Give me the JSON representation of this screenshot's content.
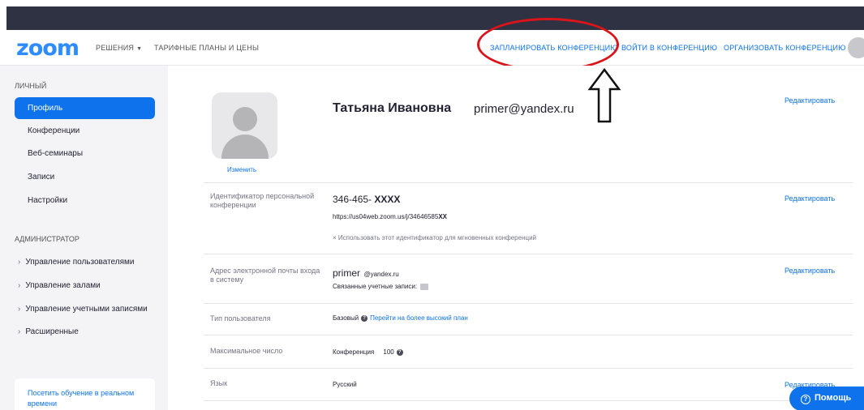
{
  "nav": {
    "logo": "zoom",
    "solutions": "РЕШЕНИЯ",
    "plans": "ТАРИФНЫЕ ПЛАНЫ И ЦЕНЫ",
    "schedule": "ЗАПЛАНИРОВАТЬ КОНФЕРЕНЦИЮ",
    "join": "ВОЙТИ В КОНФЕРЕНЦИЮ",
    "host": "ОРГАНИЗОВАТЬ КОНФЕРЕНЦИЮ"
  },
  "sidebar": {
    "personal_label": "ЛИЧНЫЙ",
    "items": [
      {
        "label": "Профиль"
      },
      {
        "label": "Конференции"
      },
      {
        "label": "Веб-семинары"
      },
      {
        "label": "Записи"
      },
      {
        "label": "Настройки"
      }
    ],
    "admin_label": "АДМИНИСТРАТОР",
    "admin_items": [
      {
        "label": "Управление пользователями"
      },
      {
        "label": "Управление залами"
      },
      {
        "label": "Управление учетными записями"
      },
      {
        "label": "Расширенные"
      }
    ],
    "training": "Посетить обучение в реальном времени"
  },
  "profile": {
    "change_photo": "Изменить",
    "name": "Татьяна Ивановна",
    "email": "primer@yandex.ru",
    "edit": "Редактировать"
  },
  "rows": {
    "pmi": {
      "label": "Идентификатор персональной конференции",
      "value_prefix": "346-465- ",
      "value_mask": "XXXX",
      "link_prefix": "https://us04web.zoom.us/j/34646585",
      "link_mask": "XX",
      "option": "Использовать этот идентификатор для мгновенных конференций",
      "edit": "Редактировать"
    },
    "email": {
      "label": "Адрес электронной почты входа в систему",
      "value_user": "primer",
      "value_domain": "@yandex.ru",
      "linked": "Связанные учетные записи:",
      "edit": "Редактировать"
    },
    "user_type": {
      "label": "Тип пользователя",
      "value": "Базовый",
      "upgrade": "Перейти на более высокий план"
    },
    "capacity": {
      "label": "Максимальное число",
      "meeting": "Конференция",
      "count": "100"
    },
    "language": {
      "label": "Язык",
      "value": "Русский",
      "edit": "Редактировать"
    }
  },
  "help": {
    "label": "Помощь"
  },
  "colors": {
    "accent": "#0e72ed",
    "annotation": "#d9141a",
    "topbar": "#2f3242"
  }
}
